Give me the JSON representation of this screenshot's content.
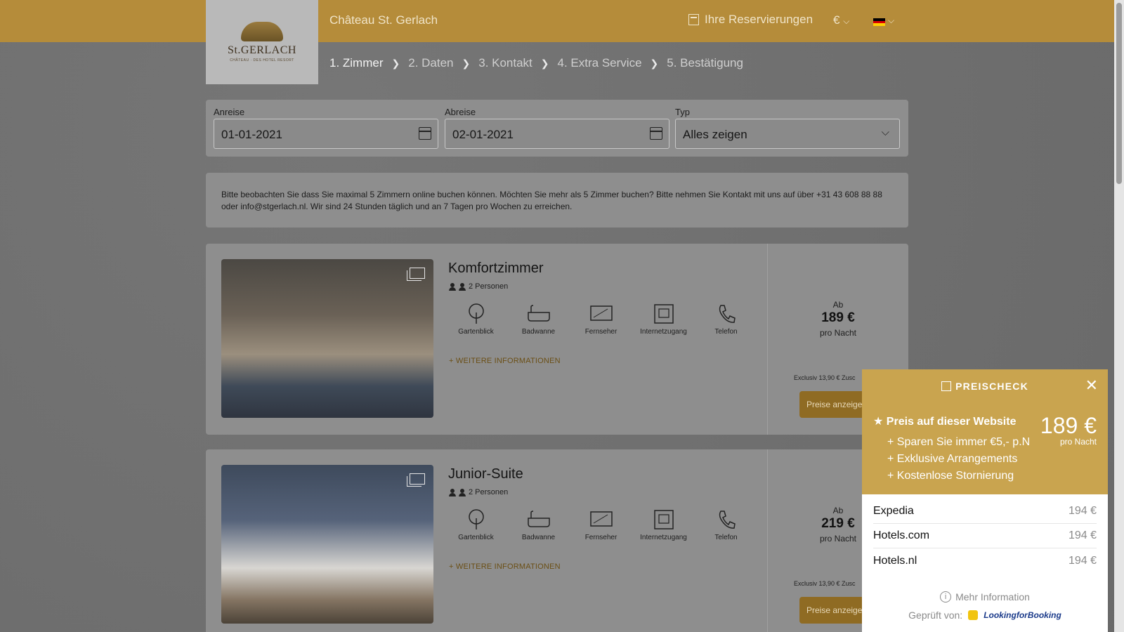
{
  "header": {
    "title": "Château St. Gerlach",
    "reservations": "Ihre Reservierungen",
    "currency": "€",
    "caret": "⌵",
    "flag_colors": [
      "#000000",
      "#dd0000",
      "#ffce00"
    ]
  },
  "logo": {
    "text": "St.GERLACH",
    "sub": "CHÂTEAU · DES HOTEL RESORT"
  },
  "steps": [
    {
      "label": "1. Zimmer",
      "active": true
    },
    {
      "label": "2. Daten"
    },
    {
      "label": "3. Kontakt"
    },
    {
      "label": "4. Extra Service"
    },
    {
      "label": "5. Bestätigung"
    }
  ],
  "step_sep": "❯",
  "search": {
    "arrival_label": "Anreise",
    "arrival_value": "01-01-2021",
    "departure_label": "Abreise",
    "departure_value": "02-01-2021",
    "type_label": "Typ",
    "type_value": "Alles zeigen",
    "type_caret": "⌵"
  },
  "notice": "Bitte beobachten Sie dass Sie maximal 5 Zimmern online buchen können. Möchten Sie mehr als 5 Zimmer buchen? Bitte nehmen Sie Kontakt mit uns auf über +31 43 608 88 88 oder info@stgerlach.nl. Wir sind 24 Stunden täglich und an 7 Tagen pro Wochen zu erreichen.",
  "rooms": [
    {
      "name": "Komfortzimmer",
      "persons": "2 Personen",
      "amenities": [
        "Gartenblick",
        "Badwanne",
        "Fernseher",
        "Internetzugang",
        "Telefon"
      ],
      "more_info": "+ WEITERE INFORMATIONEN",
      "ab": "Ab",
      "price": "189 €",
      "per_night": "pro Nacht",
      "excl": "Exclusiv 13,90 € Zusc",
      "button": "Preise anzeige"
    },
    {
      "name": "Junior-Suite",
      "persons": "2 Personen",
      "amenities": [
        "Gartenblick",
        "Badwanne",
        "Fernseher",
        "Internetzugang",
        "Telefon"
      ],
      "more_info": "+ WEITERE INFORMATIONEN",
      "ab": "Ab",
      "price": "219 €",
      "per_night": "pro Nacht",
      "excl": "Exclusiv 13,90 € Zusc",
      "button": "Preise anzeige"
    }
  ],
  "amenity_icons": [
    "tree-icon",
    "bathtub-icon",
    "tv-icon",
    "network-icon",
    "phone-icon"
  ],
  "pricecheck": {
    "title": "PREISCHECK",
    "close": "✕",
    "star": "★",
    "site_label": "Preis auf dieser Website",
    "benefits": [
      "+ Sparen Sie immer €5,- p.N",
      "+ Exklusive Arrangements",
      "+ Kostenlose Stornierung"
    ],
    "price": "189 €",
    "per_night": "pro Nacht",
    "competitors": [
      {
        "name": "Expedia",
        "price": "194 €"
      },
      {
        "name": "Hotels.com",
        "price": "194 €"
      },
      {
        "name": "Hotels.nl",
        "price": "194 €"
      }
    ],
    "info_glyph": "i",
    "more_info": "Mehr Information",
    "checked_by": "Geprüft von:",
    "brand": "LookingforBooking"
  }
}
